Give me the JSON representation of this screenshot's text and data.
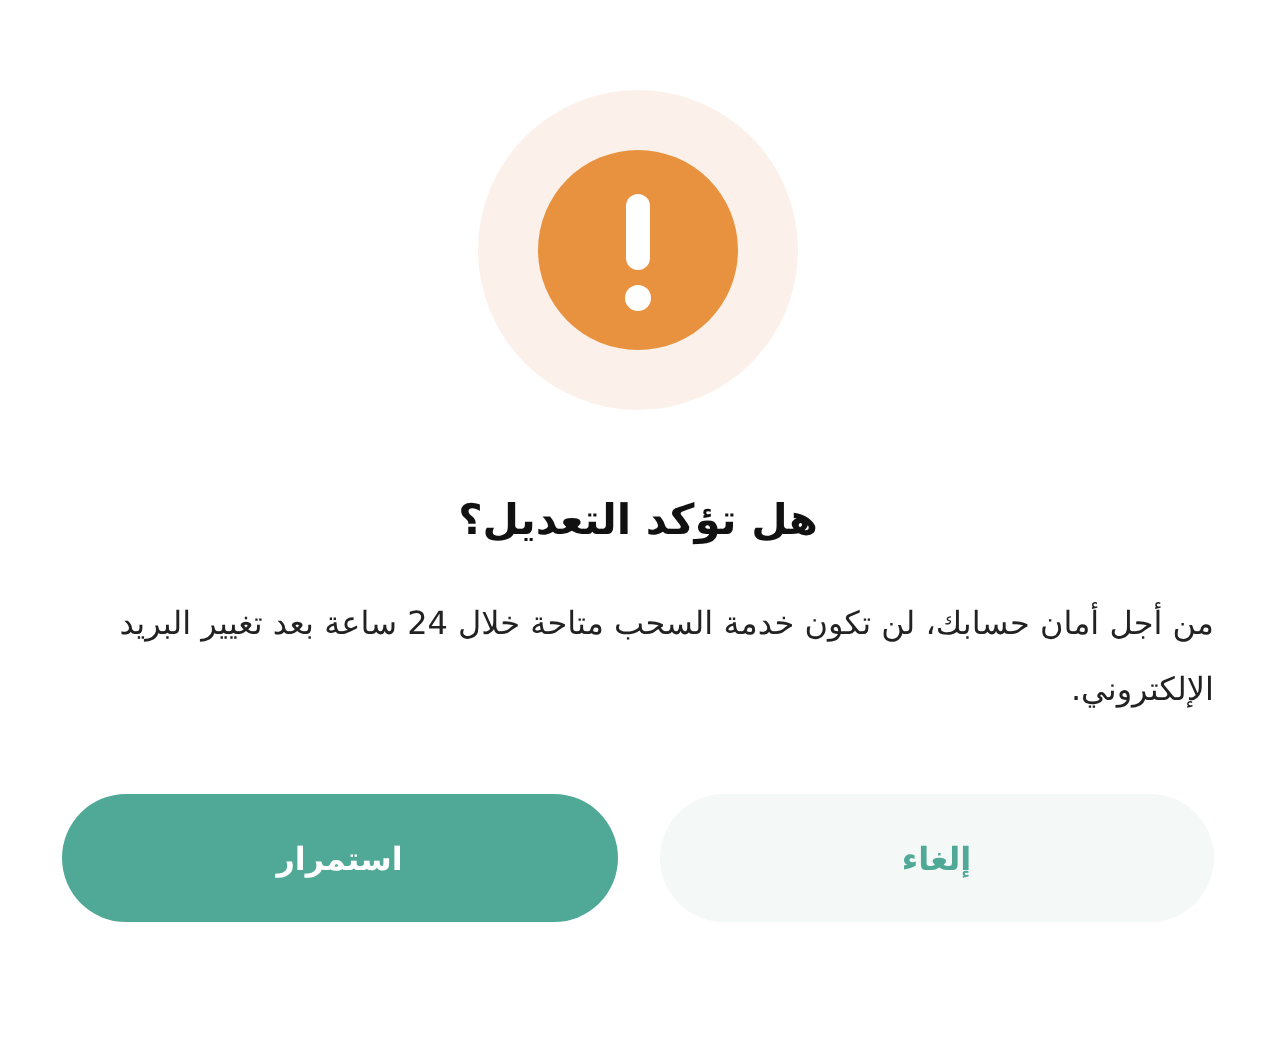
{
  "dialog": {
    "title": "هل تؤكد التعديل؟",
    "message": "من أجل أمان حسابك، لن تكون خدمة السحب متاحة خلال 24 ساعة بعد تغيير البريد الإلكتروني.",
    "buttons": [
      {
        "label": "إلغاء",
        "kind": "secondary"
      },
      {
        "label": "استمرار",
        "kind": "primary"
      }
    ]
  }
}
